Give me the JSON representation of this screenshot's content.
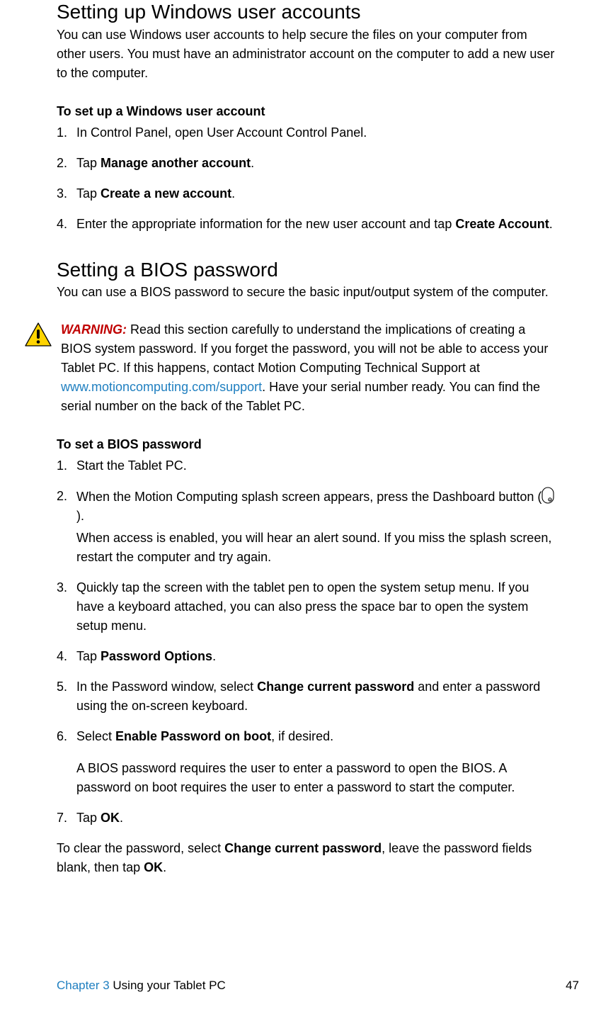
{
  "section1": {
    "heading": "Setting up Windows user accounts",
    "intro": "You can use Windows user accounts to help secure the files on your computer from other users. You must have an administrator account on the computer to add a new user to the computer.",
    "task_title": "To set up a Windows user account",
    "step1": "In Control Panel, open User Account Control Panel.",
    "step2_pre": "Tap ",
    "step2_b": "Manage another account",
    "step2_post": ".",
    "step3_pre": "Tap ",
    "step3_b": "Create a new account",
    "step3_post": ".",
    "step4_pre": "Enter the appropriate information for the new user account and tap ",
    "step4_b": "Create Account",
    "step4_post": "."
  },
  "section2": {
    "heading": "Setting a BIOS password",
    "intro": "You can use a BIOS password to secure the basic input/output system of the computer.",
    "warn_label": "WARNING:",
    "warn_a": " Read this section carefully to understand the implications of creating a BIOS system password. If you forget the password, you will not be able to access your Tablet PC. If this happens, contact Motion Computing Technical Support at ",
    "warn_link": "www.motioncomputing.com/support",
    "warn_b": ". Have your serial number ready. You can find the serial number on the back of the Tablet PC.",
    "task_title": "To set a BIOS password",
    "step1": "Start the Tablet PC.",
    "step2_a": "When the Motion Computing splash screen appears, press the Dashboard button (",
    "step2_b": ").",
    "step2_sub": "When access is enabled, you will hear an alert sound. If you miss the splash screen, restart the computer and try again.",
    "step3": "Quickly tap the screen with the tablet pen to open the system setup menu. If you have a keyboard attached, you can also press the space bar to open the system setup menu.",
    "step4_pre": "Tap ",
    "step4_b": "Password Options",
    "step4_post": ".",
    "step5_pre": "In the Password window, select ",
    "step5_b": "Change current password",
    "step5_post": " and enter a password using the on-screen keyboard.",
    "step6_pre": "Select ",
    "step6_b": "Enable Password on boot",
    "step6_post": ", if desired.",
    "step6_sub": "A BIOS password requires the user to enter a password to open the BIOS. A password on boot requires the user to enter a password to start the computer.",
    "step7_pre": "Tap ",
    "step7_b": "OK",
    "step7_post": ".",
    "clear_a": "To clear the password, select ",
    "clear_b": "Change current password",
    "clear_c": ", leave the password fields blank, then tap ",
    "clear_d": "OK",
    "clear_e": "."
  },
  "footer": {
    "chapter_ref": "Chapter 3",
    "chapter_title": "  Using your Tablet PC",
    "page_number": "47"
  }
}
